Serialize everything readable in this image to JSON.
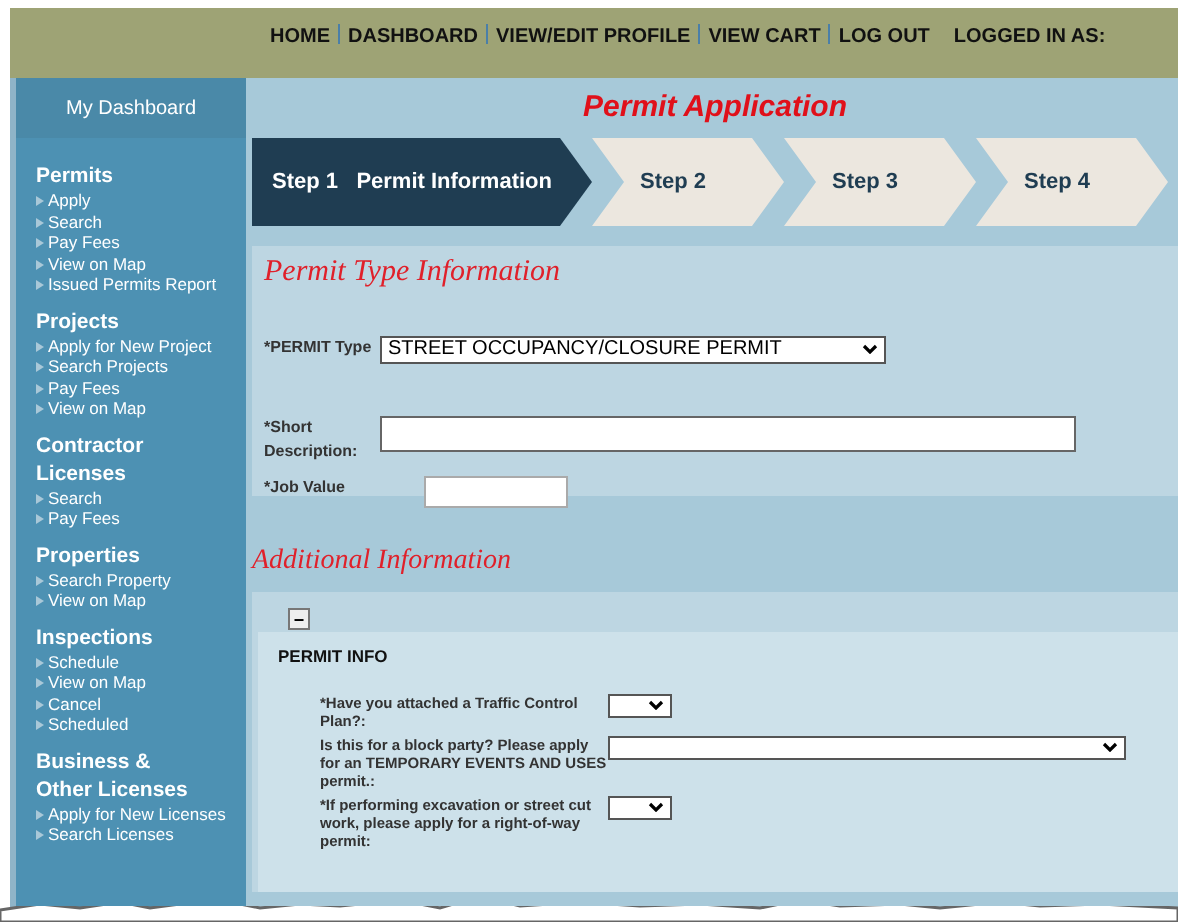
{
  "top_nav": {
    "links": [
      "HOME",
      "DASHBOARD",
      "VIEW/EDIT PROFILE",
      "VIEW CART",
      "LOG OUT"
    ],
    "logged_in": "LOGGED IN AS:"
  },
  "sidebar": {
    "title": "My Dashboard",
    "sections": [
      {
        "heading": "Permits",
        "items": [
          "Apply",
          "Search",
          "Pay Fees",
          "View on Map",
          "Issued Permits Report"
        ]
      },
      {
        "heading": "Projects",
        "items": [
          "Apply for New Project",
          "Search Projects",
          "Pay Fees",
          "View on Map"
        ]
      },
      {
        "heading": "Contractor Licenses",
        "items": [
          "Search",
          "Pay Fees"
        ]
      },
      {
        "heading": "Properties",
        "items": [
          "Search Property",
          "View on Map"
        ]
      },
      {
        "heading": "Inspections",
        "items": [
          "Schedule",
          "View on Map",
          "Cancel",
          "Scheduled"
        ]
      },
      {
        "heading": "Business & Other Licenses",
        "items": [
          "Apply for New Licenses",
          "Search Licenses"
        ]
      }
    ]
  },
  "page_title": "Permit Application",
  "steps": [
    {
      "number": "Step 1",
      "label": "Permit Information",
      "selected": true
    },
    {
      "number": "Step 2",
      "selected": false
    },
    {
      "number": "Step 3",
      "selected": false
    },
    {
      "number": "Step 4",
      "selected": false
    }
  ],
  "permit_type_section": {
    "heading": "Permit Type Information",
    "fields": [
      {
        "kind": "select",
        "label": "*PERMIT Type",
        "value": "STREET OCCUPANCY/CLOSURE PERMIT"
      },
      {
        "kind": "text",
        "label": "*Short Description:"
      },
      {
        "kind": "short",
        "label": "*Job Value"
      }
    ]
  },
  "additional_section": {
    "heading": "Additional Information",
    "collapse": "−",
    "group_title": "PERMIT INFO",
    "questions": [
      {
        "label": "*Have you attached a Traffic Control Plan?:",
        "kind": "small"
      },
      {
        "label": "Is this for a block party? Please apply for an TEMPORARY EVENTS AND USES permit.:",
        "kind": "wide"
      },
      {
        "label": "*If performing excavation or street cut work, please apply for a right-of-way permit:",
        "kind": "small"
      }
    ]
  }
}
